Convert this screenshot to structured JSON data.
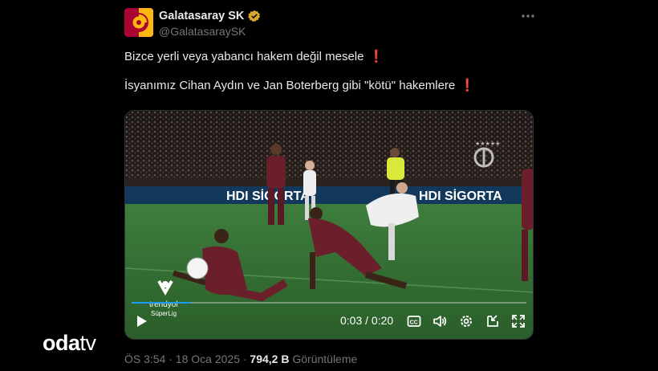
{
  "author": {
    "name": "Galatasaray SK",
    "handle": "@GalatasaraySK",
    "colors": {
      "red": "#a90432",
      "yellow": "#fdb912"
    }
  },
  "more_icon": "more-horizontal-icon",
  "tweet": {
    "line1": "Bizce yerli veya yabancı hakem değil mesele",
    "line2": "İsyanımız Cihan Aydın ve Jan Boterberg gibi \"kötü\" hakemlere",
    "emoji": "❗"
  },
  "video": {
    "time": "0:03 / 0:20",
    "progress": 0.15,
    "overlay_logo": "trendyol Süperlig",
    "ad_board": [
      "HDI SİGORTA",
      "HDI SİGORTA"
    ],
    "icons": [
      "play-icon",
      "captions-icon",
      "volume-icon",
      "settings-icon",
      "dock-icon",
      "fullscreen-icon"
    ]
  },
  "meta": {
    "time_date": "ÖS 3:54 · 18 Oca 2025 ·",
    "views": "794,2 B",
    "views_label": "Görüntüleme"
  },
  "watermark": {
    "part1": "oda",
    "part2": "tv"
  },
  "colors": {
    "accent": "#1d9bf0",
    "muted": "#71767b",
    "text": "#e7e9ea",
    "background": "#000000"
  }
}
